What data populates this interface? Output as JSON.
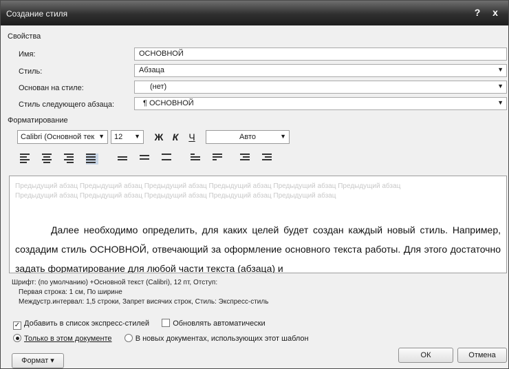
{
  "window": {
    "title": "Создание стиля",
    "help_label": "?",
    "close_label": "x"
  },
  "properties": {
    "section_label": "Свойства",
    "name_label": "Имя:",
    "name_value": "ОСНОВНОЙ",
    "style_label": "Стиль:",
    "style_value": "Абзаца",
    "based_on_label": "Основан на стиле:",
    "based_on_value": "(нет)",
    "next_style_label": "Стиль следующего абзаца:",
    "next_style_value": "¶ ОСНОВНОЙ"
  },
  "formatting": {
    "section_label": "Форматирование",
    "font": "Calibri (Основной тек",
    "size": "12",
    "bold_label": "Ж",
    "italic_label": "К",
    "underline_label": "Ч",
    "color": "Авто"
  },
  "preview": {
    "faint_text": "Предыдущий абзац Предыдущий абзац Предыдущий абзац Предыдущий абзац Предыдущий абзац Предыдущий абзац Предыдущий абзац Предыдущий абзац Предыдущий абзац Предыдущий абзац Предыдущий абзац",
    "main_text": "Далее необходимо определить, для каких целей будет создан каждый новый стиль. Например, создадим стиль ОСНОВНОЙ, отвечающий за оформление основного текста работы. Для этого достаточно задать форматирование для любой части текста (абзаца) и"
  },
  "description": {
    "line1": "Шрифт: (по умолчанию) +Основной текст (Calibri), 12 пт, Отступ:",
    "line2": "Первая строка: 1 см, По ширине",
    "line3": "Междустр.интервал: 1,5 строки, Запрет висячих строк, Стиль: Экспресс-стиль"
  },
  "options": {
    "add_to_quick": "Добавить в список экспресс-стилей",
    "auto_update": "Обновлять автоматически",
    "only_this_doc": "Только в этом документе",
    "new_docs": "В новых документах, использующих этот шаблон"
  },
  "buttons": {
    "format": "Формат ▾",
    "ok": "ОК",
    "cancel": "Отмена"
  }
}
